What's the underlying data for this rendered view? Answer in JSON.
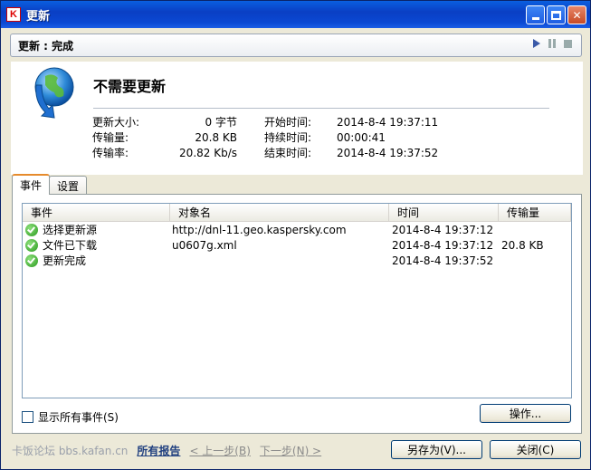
{
  "window": {
    "title": "更新",
    "app_icon": "K"
  },
  "status": {
    "label": "更新 : 完成"
  },
  "summary": {
    "headline": "不需要更新",
    "stats_left": [
      {
        "label": "更新大小:",
        "value": "0 字节"
      },
      {
        "label": "传输量:",
        "value": "20.8 KB"
      },
      {
        "label": "传输率:",
        "value": "20.82 Kb/s"
      }
    ],
    "stats_right": [
      {
        "label": "开始时间:",
        "value": "2014-8-4 19:37:11"
      },
      {
        "label": "持续时间:",
        "value": "00:00:41"
      },
      {
        "label": "结束时间:",
        "value": "2014-8-4 19:37:52"
      }
    ]
  },
  "tabs": [
    {
      "label": "事件"
    },
    {
      "label": "设置"
    }
  ],
  "table": {
    "columns": [
      "事件",
      "对象名",
      "时间",
      "传输量"
    ],
    "rows": [
      {
        "event": "选择更新源",
        "object": "http://dnl-11.geo.kaspersky.com",
        "time": "2014-8-4 19:37:12",
        "size": ""
      },
      {
        "event": "文件已下载",
        "object": "u0607g.xml",
        "time": "2014-8-4 19:37:12",
        "size": "20.8 KB"
      },
      {
        "event": "更新完成",
        "object": "",
        "time": "2014-8-4 19:37:52",
        "size": ""
      }
    ]
  },
  "show_all_label": "显示所有事件(S)",
  "action_button": "操作...",
  "footer": {
    "watermark": "卡饭论坛 bbs.kafan.cn",
    "report_link": "所有报告",
    "prev_link": "< 上一步(B)",
    "next_link": "下一步(N) >",
    "save_as": "另存为(V)...",
    "close": "关闭(C)"
  },
  "colors": {
    "title_bar": "#0a3fc4",
    "ok_green": "#2a9a1f",
    "report_link": "#1f3f7f"
  }
}
